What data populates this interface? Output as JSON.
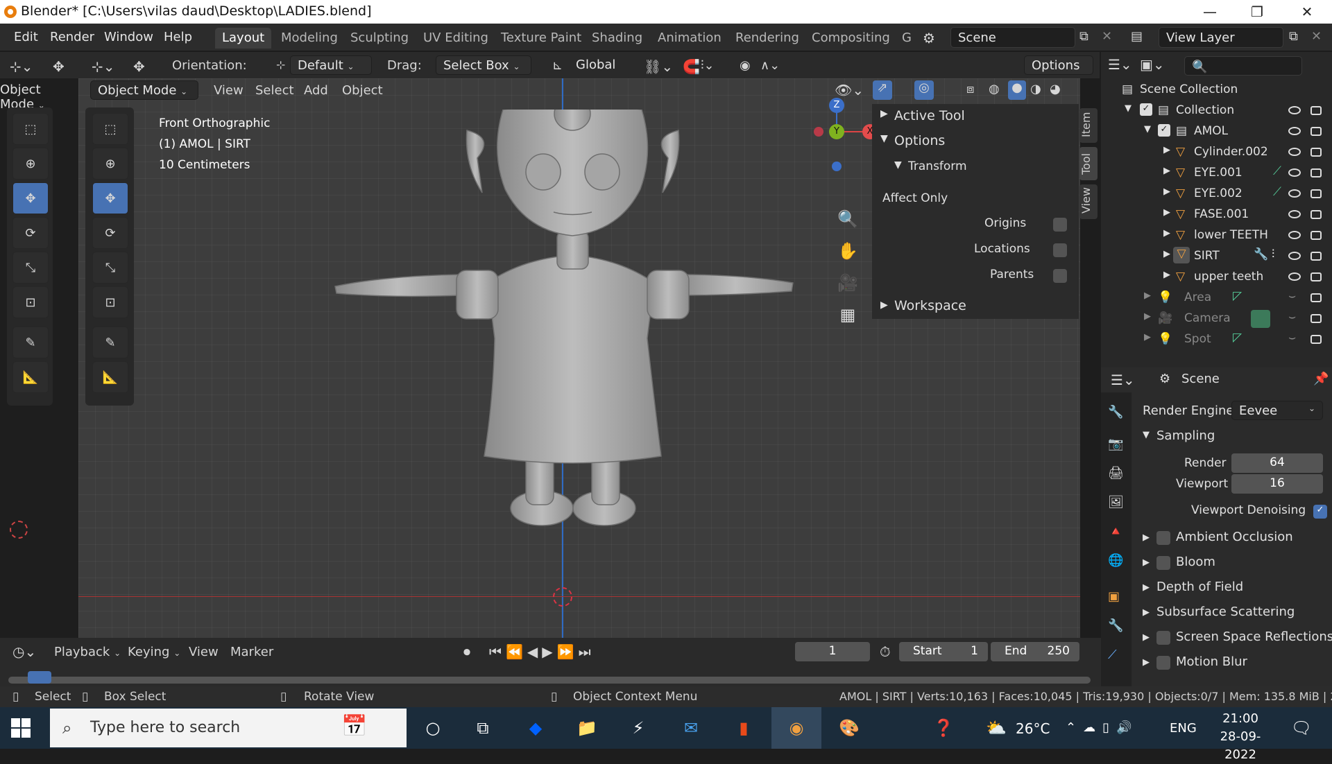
{
  "window": {
    "title": "Blender* [C:\\Users\\vilas daud\\Desktop\\LADIES.blend]",
    "min": "—",
    "max": "❐",
    "close": "✕"
  },
  "menu": [
    "Edit",
    "Render",
    "Window",
    "Help"
  ],
  "workspaces": [
    "Layout",
    "Modeling",
    "Sculpting",
    "UV Editing",
    "Texture Paint",
    "Shading",
    "Animation",
    "Rendering",
    "Compositing",
    "G"
  ],
  "scene": {
    "label": "Scene",
    "view_layer": "View Layer"
  },
  "toolheader": {
    "orientation_label": "Orientation:",
    "orientation_value": "Default",
    "drag_label": "Drag:",
    "drag_value": "Select Box",
    "transform_value": "Global",
    "options": "Options"
  },
  "left_mode": "Object Mode",
  "viewport_header": {
    "mode": "Object Mode",
    "items": [
      "View",
      "Select",
      "Add",
      "Object"
    ]
  },
  "overlay_text": {
    "view": "Front Orthographic",
    "object": "(1) AMOL | SIRT",
    "scale": "10 Centimeters"
  },
  "gizmo": {
    "z": "Z",
    "y": "Y",
    "x": "X"
  },
  "npanel": {
    "active_tool": "Active Tool",
    "options": "Options",
    "transform": "Transform",
    "affect_only": "Affect Only",
    "origins": "Origins",
    "locations": "Locations",
    "parents": "Parents",
    "workspace": "Workspace",
    "tabs": [
      "Item",
      "Tool",
      "View"
    ]
  },
  "outliner": {
    "root": "Scene Collection",
    "items": [
      {
        "name": "Collection",
        "level": 1
      },
      {
        "name": "AMOL",
        "level": 2
      },
      {
        "name": "Cylinder.002",
        "level": 3
      },
      {
        "name": "EYE.001",
        "level": 3
      },
      {
        "name": "EYE.002",
        "level": 3
      },
      {
        "name": "FASE.001",
        "level": 3
      },
      {
        "name": "lower TEETH",
        "level": 3
      },
      {
        "name": "SIRT",
        "level": 3
      },
      {
        "name": "upper teeth",
        "level": 3
      },
      {
        "name": "Area",
        "level": 2
      },
      {
        "name": "Camera",
        "level": 2
      },
      {
        "name": "Spot",
        "level": 2
      }
    ]
  },
  "properties": {
    "context": "Scene",
    "render_engine_label": "Render Engine",
    "render_engine": "Eevee",
    "sampling": "Sampling",
    "render_label": "Render",
    "render_value": "64",
    "viewport_label": "Viewport",
    "viewport_value": "16",
    "denoise": "Viewport Denoising",
    "panels": [
      "Ambient Occlusion",
      "Bloom",
      "Depth of Field",
      "Subsurface Scattering",
      "Screen Space Reflections",
      "Motion Blur"
    ]
  },
  "timeline": {
    "playback": "Playback",
    "keying": "Keying",
    "view": "View",
    "marker": "Marker",
    "frame": "1",
    "start_label": "Start",
    "start": "1",
    "end_label": "End",
    "end": "250"
  },
  "status": {
    "select": "Select",
    "box_select": "Box Select",
    "rotate": "Rotate View",
    "context_menu": "Object Context Menu",
    "stats": "AMOL | SIRT | Verts:10,163 | Faces:10,045 | Tris:19,930 | Objects:0/7 | Mem: 135.8 MiB | 2."
  },
  "taskbar": {
    "search": "Type here to search",
    "temp": "26°C",
    "lang": "ENG",
    "time": "21:00",
    "date": "28-09-2022"
  }
}
